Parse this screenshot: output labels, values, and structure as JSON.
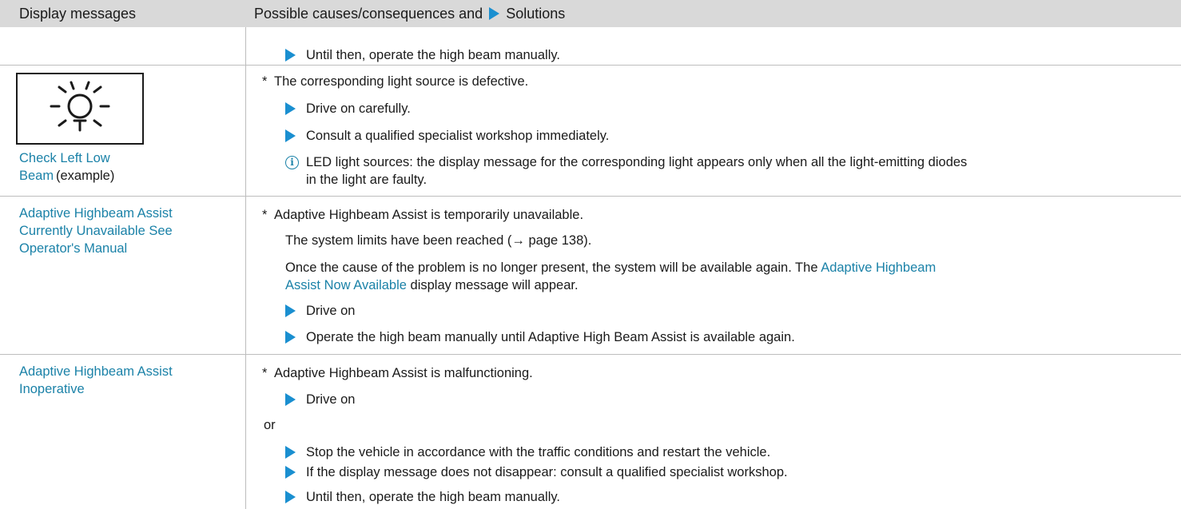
{
  "header": {
    "col1": "Display messages",
    "col2_prefix": "Possible causes/consequences and",
    "col2_suffix": "Solutions"
  },
  "row0": {
    "step1": "Until then, operate the high beam manually."
  },
  "row1": {
    "icon": "low-beam-lamp-icon",
    "msg_link": "Check Left Low Beam",
    "msg_suffix": "(example)",
    "cause": "The corresponding light source is defective.",
    "step1": "Drive on carefully.",
    "step2": "Consult a qualified specialist workshop immediately.",
    "info_line1": "LED light sources: the display message for the corresponding light appears only when all the light-emitting diodes",
    "info_line2": "in the light are faulty."
  },
  "row2": {
    "msg_line1": "Adaptive Highbeam Assist",
    "msg_line2": "Currently Unavailable See",
    "msg_line3": "Operator's Manual",
    "cause": "Adaptive Highbeam Assist is temporarily unavailable.",
    "limits": "The system limits have been reached (→ page 138).",
    "once_prefix": "Once the cause of the problem is no longer present, the system will be available again. The",
    "once_link1": "Adaptive Highbeam",
    "once_link2": "Assist Now Available",
    "once_suffix": "display message will appear.",
    "step1": "Drive on",
    "step2": "Operate the high beam manually until Adaptive High Beam Assist is available again."
  },
  "row3": {
    "msg_line1": "Adaptive Highbeam Assist",
    "msg_line2": "Inoperative",
    "cause": "Adaptive Highbeam Assist is malfunctioning.",
    "step1": "Drive on",
    "or": "or",
    "step2": "Stop the vehicle in accordance with the traffic conditions and restart the vehicle.",
    "step3": "If the display message does not disappear: consult a qualified specialist workshop.",
    "step4": "Until then, operate the high beam manually."
  },
  "colors": {
    "link": "#1b82a8",
    "arrow": "#1a8fd0",
    "header_bg": "#d9d9d9"
  }
}
